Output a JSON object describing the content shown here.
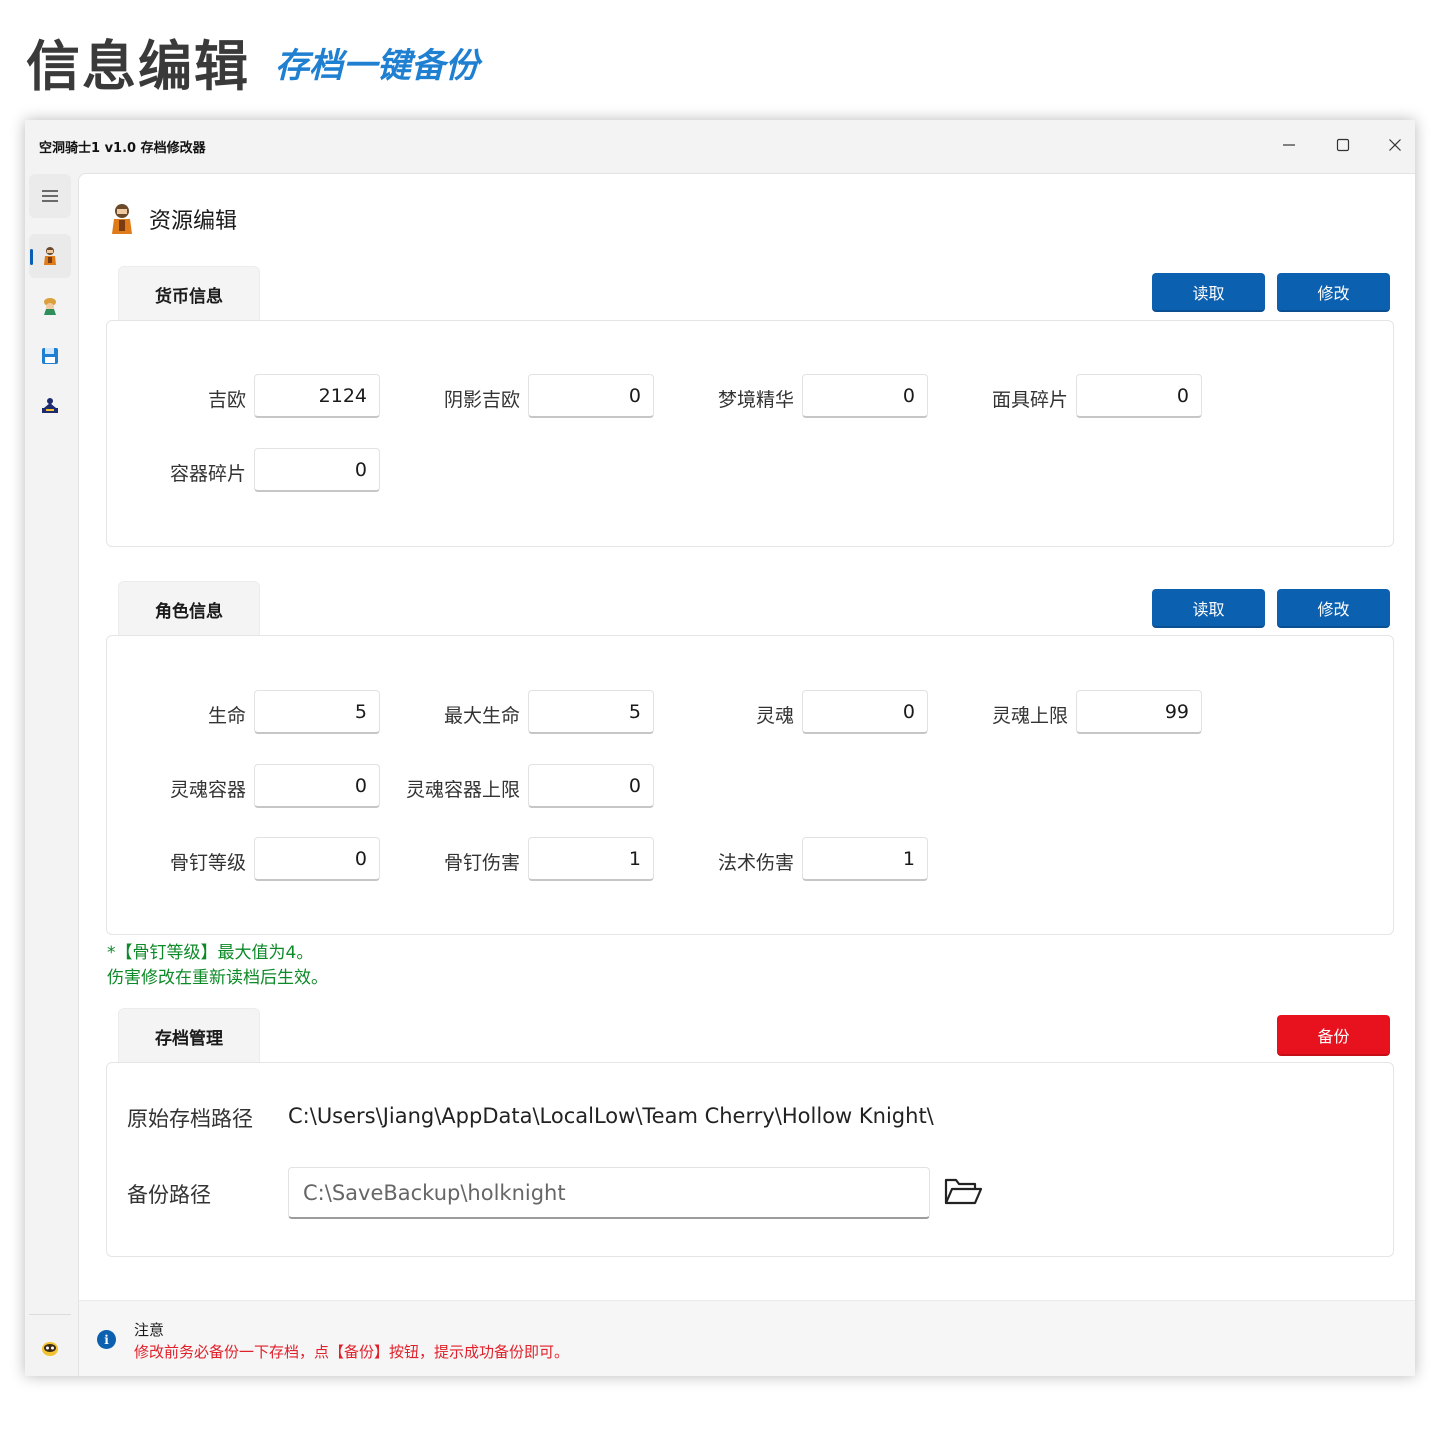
{
  "promo": {
    "title": "信息编辑",
    "subtitle": "存档一键备份"
  },
  "window": {
    "title": "空洞骑士1 v1.0 存档修改器",
    "controls": {
      "minimize": "minimize-icon",
      "maximize": "maximize-icon",
      "close": "close-icon"
    }
  },
  "sidebar": {
    "items": [
      {
        "name": "menu",
        "icon": "hamburger-menu-icon"
      },
      {
        "name": "resource-edit",
        "icon": "knight-avatar-icon",
        "selected": true
      },
      {
        "name": "page-2",
        "icon": "character-avatar-icon"
      },
      {
        "name": "save",
        "icon": "floppy-disk-icon"
      },
      {
        "name": "page-4",
        "icon": "map-figure-icon"
      },
      {
        "name": "footer",
        "icon": "mask-character-icon"
      }
    ]
  },
  "page": {
    "title": "资源编辑",
    "icon": "knight-avatar-icon"
  },
  "currency": {
    "tab": "货币信息",
    "read_label": "读取",
    "modify_label": "修改",
    "fields": [
      {
        "label": "吉欧",
        "value": "2124"
      },
      {
        "label": "阴影吉欧",
        "value": "0"
      },
      {
        "label": "梦境精华",
        "value": "0"
      },
      {
        "label": "面具碎片",
        "value": "0"
      },
      {
        "label": "容器碎片",
        "value": "0"
      }
    ]
  },
  "character": {
    "tab": "角色信息",
    "read_label": "读取",
    "modify_label": "修改",
    "fields": [
      {
        "label": "生命",
        "value": "5"
      },
      {
        "label": "最大生命",
        "value": "5"
      },
      {
        "label": "灵魂",
        "value": "0"
      },
      {
        "label": "灵魂上限",
        "value": "99"
      },
      {
        "label": "灵魂容器",
        "value": "0"
      },
      {
        "label": "灵魂容器上限",
        "value": "0"
      },
      {
        "label": "骨钉等级",
        "value": "0"
      },
      {
        "label": "骨钉伤害",
        "value": "1"
      },
      {
        "label": "法术伤害",
        "value": "1"
      }
    ],
    "notes": [
      "*【骨钉等级】最大值为4。",
      "伤害修改在重新读档后生效。"
    ]
  },
  "save_mgmt": {
    "tab": "存档管理",
    "backup_label": "备份",
    "original_path_label": "原始存档路径",
    "original_path_value": "C:\\Users\\Jiang\\AppData\\LocalLow\\Team Cherry\\Hollow Knight\\",
    "backup_path_label": "备份路径",
    "backup_path_value": "C:\\SaveBackup\\holknight",
    "folder_icon": "folder-open-icon"
  },
  "info": {
    "title": "注意",
    "message": "修改前务必备份一下存档，点【备份】按钮，提示成功备份即可。",
    "icon": "info-icon"
  },
  "colors": {
    "accent": "#0c60b0",
    "danger": "#e8121e",
    "note": "#0d8a28",
    "promo_title": "#3a3a3a",
    "promo_subtitle": "#1f7fd0"
  }
}
